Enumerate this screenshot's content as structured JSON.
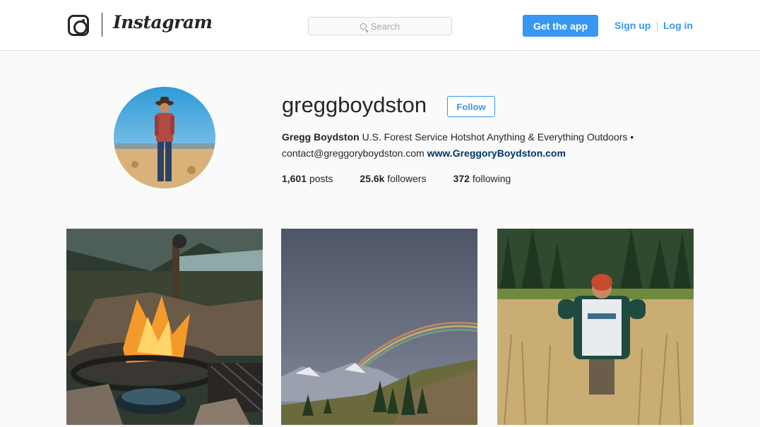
{
  "header": {
    "wordmark": "Instagram",
    "search_placeholder": "Search",
    "get_app_label": "Get the app",
    "signup_label": "Sign up",
    "separator": "|",
    "login_label": "Log in"
  },
  "profile": {
    "username": "greggboydston",
    "follow_label": "Follow",
    "full_name": "Gregg Boydston",
    "bio_text": "U.S. Forest Service Hotshot Anything & Everything Outdoors •",
    "contact": "contact@greggoryboydston.com",
    "website": "www.GreggoryBoydston.com",
    "stats": {
      "posts_count": "1,601",
      "posts_label": "posts",
      "followers_count": "25.6k",
      "followers_label": "followers",
      "following_count": "372",
      "following_label": "following"
    }
  },
  "colors": {
    "accent": "#3897f0",
    "link": "#003569",
    "background": "#fafafa"
  },
  "icons": [
    "instagram-camera-icon",
    "search-icon"
  ]
}
